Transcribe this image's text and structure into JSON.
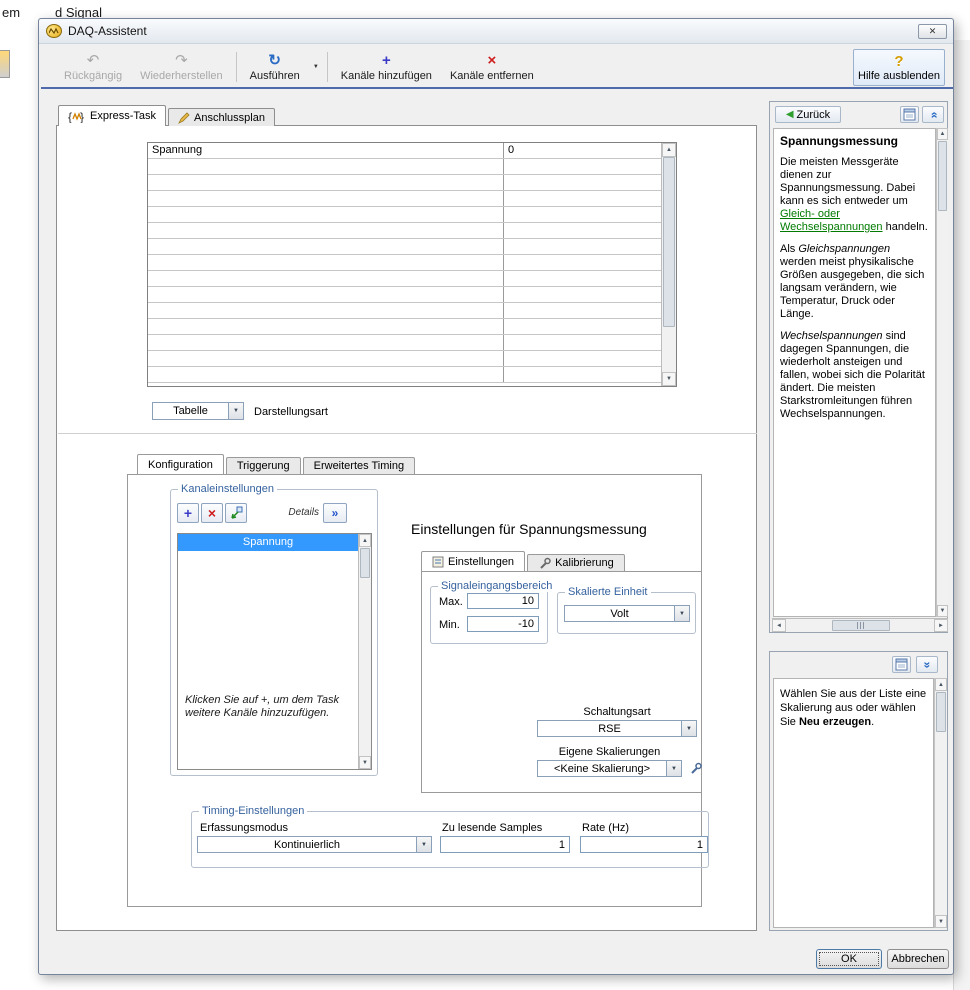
{
  "background": {
    "fragment_1": "em",
    "fragment_2": "d Signal"
  },
  "window": {
    "title": "DAQ-Assistent",
    "close_glyph": "✕"
  },
  "toolbar": {
    "undo": "Rückgängig",
    "redo": "Wiederherstellen",
    "run": "Ausführen",
    "add_channels": "Kanäle hinzufügen",
    "remove_channels": "Kanäle entfernen",
    "hide_help": "Hilfe ausblenden"
  },
  "tabs": {
    "express_task": "Express-Task",
    "wiring": "Anschlussplan"
  },
  "data_table": {
    "first_row": {
      "channel": "Spannung",
      "value": "0"
    }
  },
  "display": {
    "value": "Tabelle",
    "label": "Darstellungsart"
  },
  "config_tabs": {
    "configuration": "Konfiguration",
    "triggering": "Triggerung",
    "advanced_timing": "Erweitertes Timing"
  },
  "channel_settings": {
    "group_label": "Kanaleinstellungen",
    "details_label": "Details",
    "selected_channel": "Spannung",
    "hint": "Klicken Sie auf +, um dem Task weitere Kanäle hinzuzufügen."
  },
  "measurement": {
    "title": "Einstellungen für Spannungsmessung",
    "tabs": {
      "settings": "Einstellungen",
      "calibration": "Kalibrierung"
    },
    "signal_input_range": {
      "group_label": "Signaleingangsbereich",
      "max_label": "Max.",
      "max_value": "10",
      "min_label": "Min.",
      "min_value": "-10"
    },
    "scaled_unit": {
      "group_label": "Skalierte Einheit",
      "value": "Volt"
    },
    "terminal_config": {
      "label": "Schaltungsart",
      "value": "RSE"
    },
    "custom_scaling": {
      "label": "Eigene Skalierungen",
      "value": "<Keine Skalierung>"
    }
  },
  "timing": {
    "group_label": "Timing-Einstellungen",
    "acquisition_mode_label": "Erfassungsmodus",
    "acquisition_mode_value": "Kontinuierlich",
    "samples_label": "Zu lesende Samples",
    "samples_value": "1",
    "rate_label": "Rate (Hz)",
    "rate_value": "1"
  },
  "help": {
    "back_label": "Zurück",
    "title": "Spannungsmessung",
    "p1_a": "Die meisten Messgeräte dienen zur Spannungsmessung. Dabei kann es sich entweder um ",
    "p1_link": "Gleich- oder Wechselspannungen",
    "p1_b": " handeln.",
    "p2_a": "Als ",
    "p2_i": "Gleichspannungen",
    "p2_b": " werden meist physikalische Größen ausgegeben, die sich langsam verändern, wie Temperatur, Druck oder Länge.",
    "p3_i": "Wechselspannungen",
    "p3_b": " sind dagegen Spannungen, die wiederholt ansteigen und fallen, wobei sich die Polarität ändert. Die meisten Starkstromleitungen führen Wechselspannungen."
  },
  "scaling_help": {
    "a": "Wählen Sie aus der Liste eine Skalierung aus oder wählen Sie ",
    "b": "Neu erzeugen",
    "c": "."
  },
  "footer": {
    "ok": "OK",
    "cancel": "Abbrechen"
  },
  "colors": {
    "selection_blue": "#3399ff",
    "link_green": "#007b00",
    "group_label_blue": "#35629e",
    "toolbar_accent_blue": "#4f6bab",
    "run_icon_blue": "#2a6bc4",
    "add_icon_blue": "#3b3bc8",
    "remove_icon_red": "#cf1d1d",
    "help_icon_yellow": "#d69d00",
    "back_arrow_green": "#2f9e2f"
  }
}
